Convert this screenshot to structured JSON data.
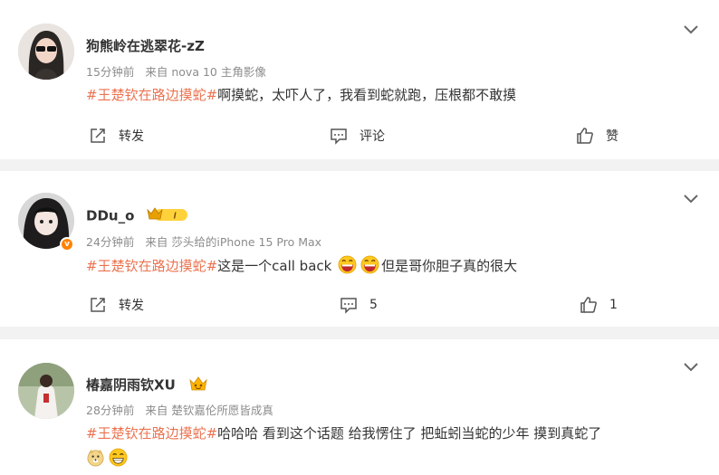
{
  "comments": [
    {
      "username": "狗熊岭在逃翠花-zZ",
      "time": "15分钟前",
      "source": "来自 nova 10 主角影像",
      "topic": "#王楚钦在路边摸蛇#",
      "text": "啊摸蛇，太吓人了，我看到蛇就跑，压根都不敢摸",
      "repost_label": "转发",
      "comment_label": "评论",
      "like_label": "赞"
    },
    {
      "username": "DDu_o",
      "time": "24分钟前",
      "source": "来自 莎头给的iPhone 15 Pro Max",
      "topic": "#王楚钦在路边摸蛇#",
      "text_before": "这是一个call back",
      "text_after": "但是哥你胆子真的很大",
      "repost_label": "转发",
      "comment_count": "5",
      "like_count": "1",
      "vip_level": "I"
    },
    {
      "username": "椿嘉阴雨钦XU",
      "time": "28分钟前",
      "source": "来自 楚钦嘉伦所愿皆成真",
      "topic": "#王楚钦在路边摸蛇#",
      "text": "哈哈哈 看到这个话题 给我愣住了 把蚯蚓当蛇的少年 摸到真蛇了"
    }
  ],
  "icons": {
    "more": "chevron-down-icon",
    "repost": "share-icon",
    "comment": "comment-icon",
    "like": "thumbs-up-icon",
    "verified": "verified-v-icon",
    "vip": "vip-crown-icon",
    "fan": "fan-crown-icon",
    "emoji": "grin-emoji-icon"
  },
  "colors": {
    "topic": "#eb7350",
    "meta": "#8c8c8c",
    "background": "#f2f2f2",
    "verified": "#ff8200"
  }
}
